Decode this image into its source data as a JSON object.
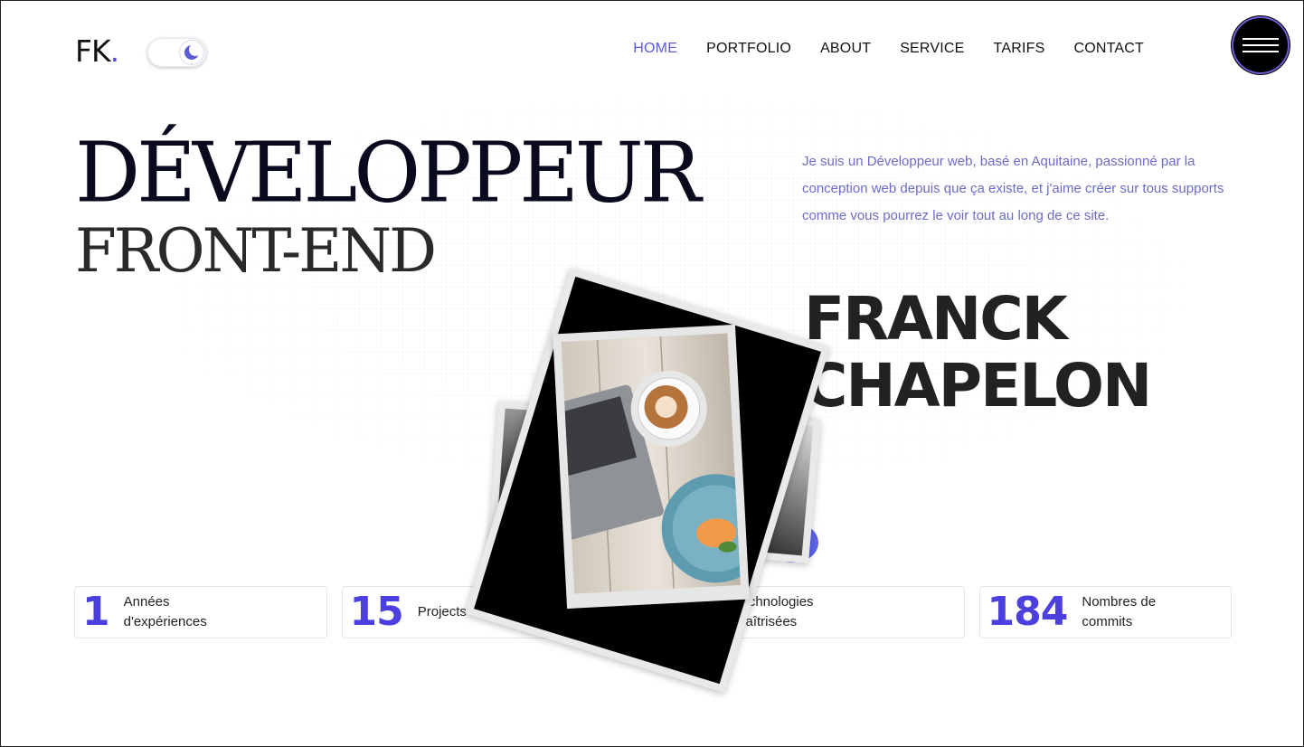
{
  "brand": {
    "logo_text": "FK",
    "logo_dot": ".",
    "accent": "#4f46e5"
  },
  "theme_toggle": {
    "icon": "moon-icon",
    "state": "dark-mode-off"
  },
  "nav": {
    "items": [
      {
        "label": "HOME",
        "active": true
      },
      {
        "label": "PORTFOLIO",
        "active": false
      },
      {
        "label": "ABOUT",
        "active": false
      },
      {
        "label": "SERVICE",
        "active": false
      },
      {
        "label": "TARIFS",
        "active": false
      },
      {
        "label": "CONTACT",
        "active": false
      }
    ],
    "active_color": "#5b5bd6",
    "menu_icon": "hamburger-icon"
  },
  "hero": {
    "title_line1": "DÉVELOPPEUR",
    "title_line2": "FRONT-END",
    "bio": "Je suis un Développeur web, basé en Aquitaine, passionné par la conception web depuis que ça existe, et j'aime créer sur tous supports comme vous pourrez le voir tout au long de ce site.",
    "name_line1": "FRANCK",
    "name_line2": "CHAPELON"
  },
  "stats": [
    {
      "value": "1",
      "label": "Années d'expériences"
    },
    {
      "value": "15",
      "label": "Projects terminés"
    },
    {
      "value": "",
      "label": "Technologies maîtrisées"
    },
    {
      "value": "184",
      "label": "Nombres de commits"
    }
  ],
  "colors": {
    "stat_number": "#4b3fe0",
    "bio_text": "#6b6bc8"
  }
}
